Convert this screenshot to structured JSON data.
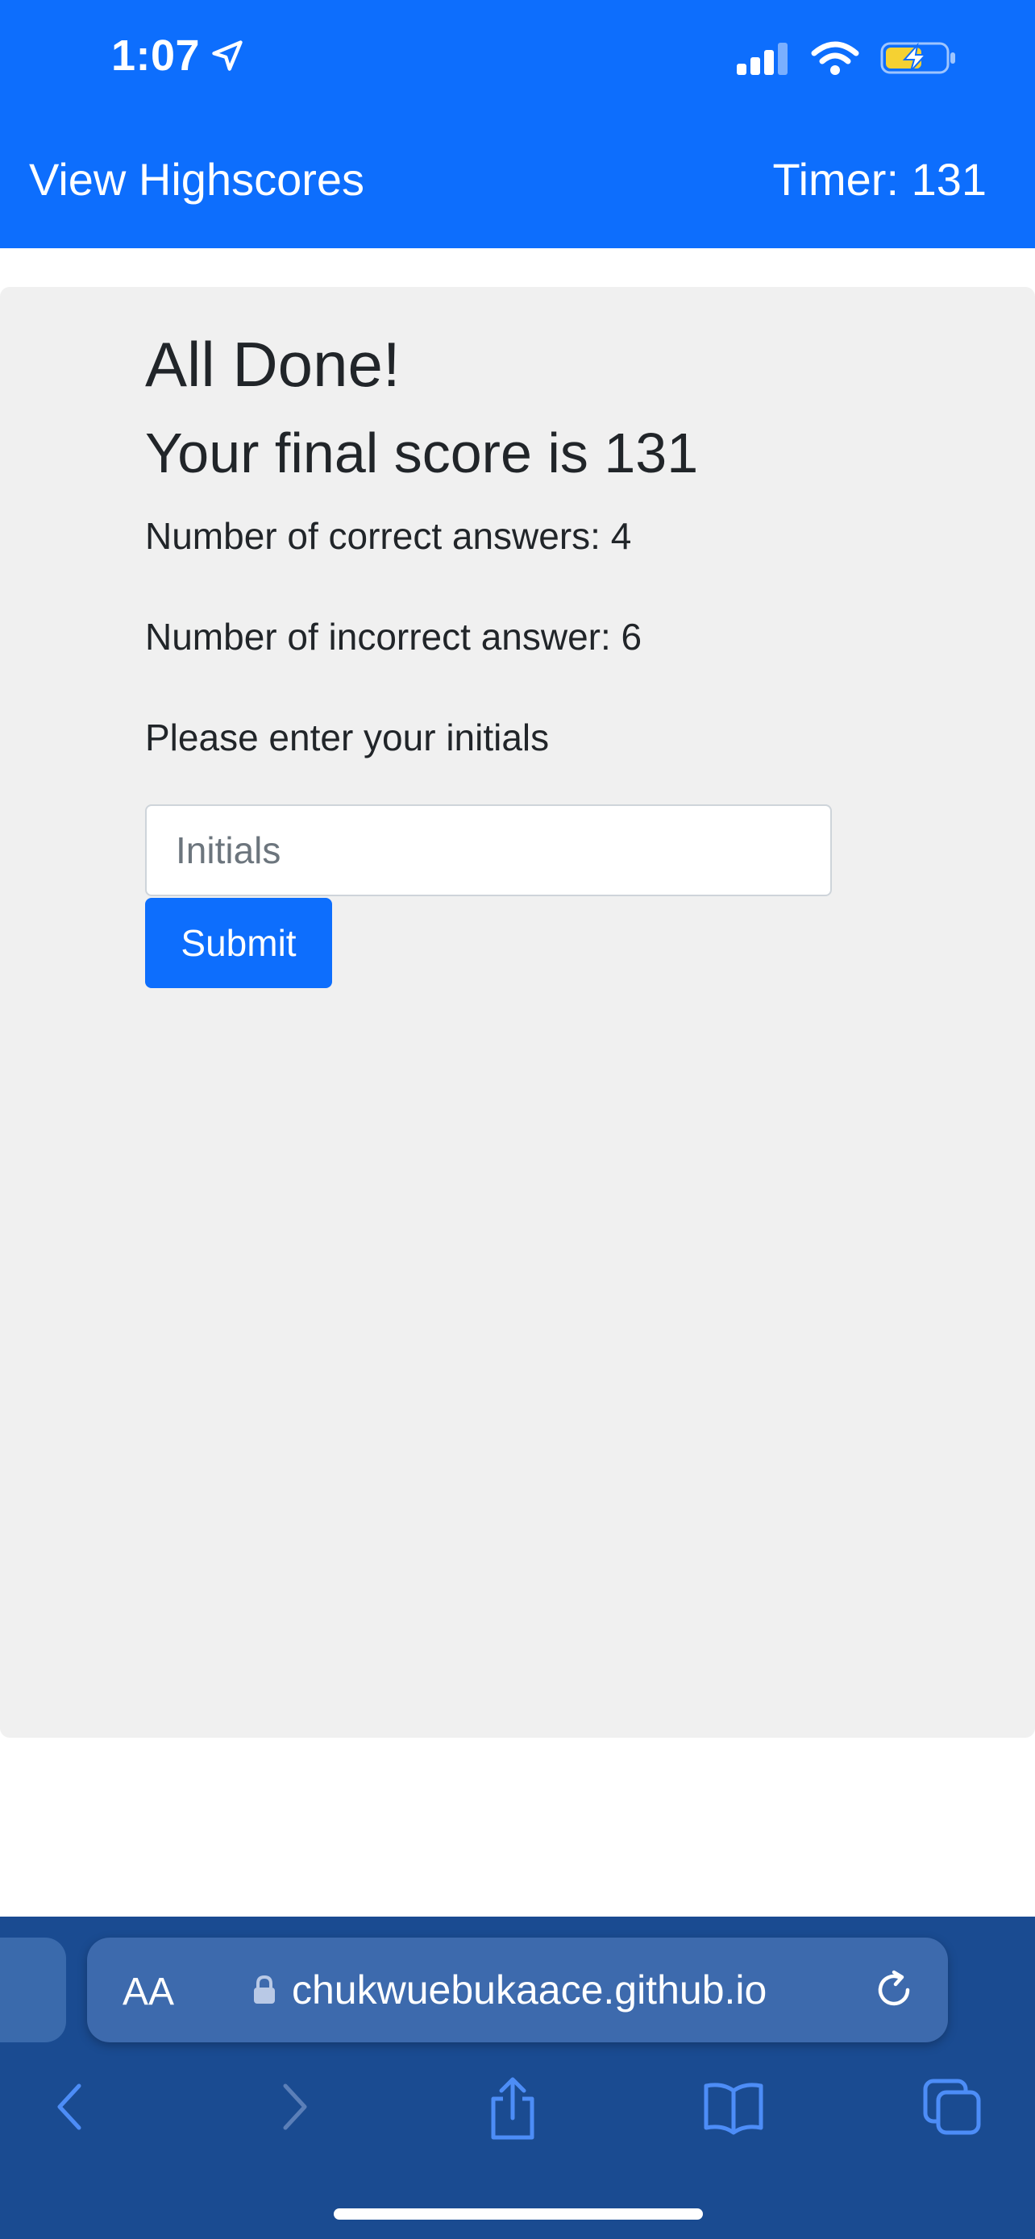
{
  "status_bar": {
    "time": "1:07",
    "icons": [
      "location-arrow-icon",
      "signal-icon",
      "wifi-icon",
      "battery-charging-icon"
    ]
  },
  "header": {
    "nav_link": "View Highscores",
    "timer": "Timer: 131"
  },
  "main": {
    "title": "All Done!",
    "score_text": "Your final score is 131",
    "correct_text": "Number of correct answers: 4",
    "incorrect_text": "Number of incorrect answer: 6",
    "prompt": "Please enter your initials",
    "initials_value": "",
    "initials_placeholder": "Initials",
    "submit_label": "Submit"
  },
  "browser": {
    "text_size_label": "AA",
    "url": "chukwuebukaace.github.io",
    "toolbar_icons": [
      "back-icon",
      "forward-icon",
      "share-icon",
      "bookmarks-icon",
      "tabs-icon"
    ]
  },
  "colors": {
    "brand_blue": "#0d6efd",
    "card_bg": "#f0f0f0",
    "safari_bar": "#1a4b91"
  }
}
